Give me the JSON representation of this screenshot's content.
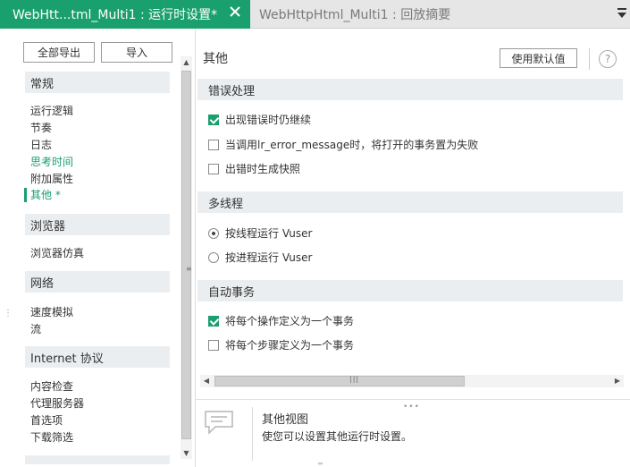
{
  "tabs": [
    {
      "label": "WebHtt...tml_Multi1 : 运行时设置*",
      "active": true
    },
    {
      "label": "WebHttpHtml_Multi1 : 回放摘要",
      "active": false
    }
  ],
  "sidebar": {
    "export_label": "全部导出",
    "import_label": "导入",
    "groups": [
      {
        "header": "常规",
        "items": [
          "运行逻辑",
          "节奏",
          "日志",
          "思考时间",
          "附加属性",
          "其他 *"
        ]
      },
      {
        "header": "浏览器",
        "items": [
          "浏览器仿真"
        ]
      },
      {
        "header": "网络",
        "items": [
          "速度模拟",
          "流"
        ]
      },
      {
        "header": "Internet 协议",
        "items": [
          "内容检查",
          "代理服务器",
          "首选项",
          "下载筛选"
        ]
      }
    ],
    "selected_item": "其他 *",
    "highlighted_item": "思考时间"
  },
  "main": {
    "title": "其他",
    "default_button": "使用默认值",
    "help_symbol": "?",
    "sections": [
      {
        "title": "错误处理",
        "options": [
          {
            "type": "checkbox",
            "label": "出现错误时仍继续",
            "checked": true
          },
          {
            "type": "checkbox",
            "label": "当调用lr_error_message时，将打开的事务置为失败",
            "checked": false
          },
          {
            "type": "checkbox",
            "label": "出错时生成快照",
            "checked": false
          }
        ]
      },
      {
        "title": "多线程",
        "options": [
          {
            "type": "radio",
            "label": "按线程运行 Vuser",
            "checked": true
          },
          {
            "type": "radio",
            "label": "按进程运行 Vuser",
            "checked": false
          }
        ]
      },
      {
        "title": "自动事务",
        "options": [
          {
            "type": "checkbox",
            "label": "将每个操作定义为一个事务",
            "checked": true
          },
          {
            "type": "checkbox",
            "label": "将每个步骤定义为一个事务",
            "checked": false
          }
        ]
      }
    ]
  },
  "info_panel": {
    "title": "其他视图",
    "description": "使您可以设置其他运行时设置。"
  },
  "colors": {
    "accent": "#1a9f6e",
    "section_bg": "#ebeef0"
  }
}
